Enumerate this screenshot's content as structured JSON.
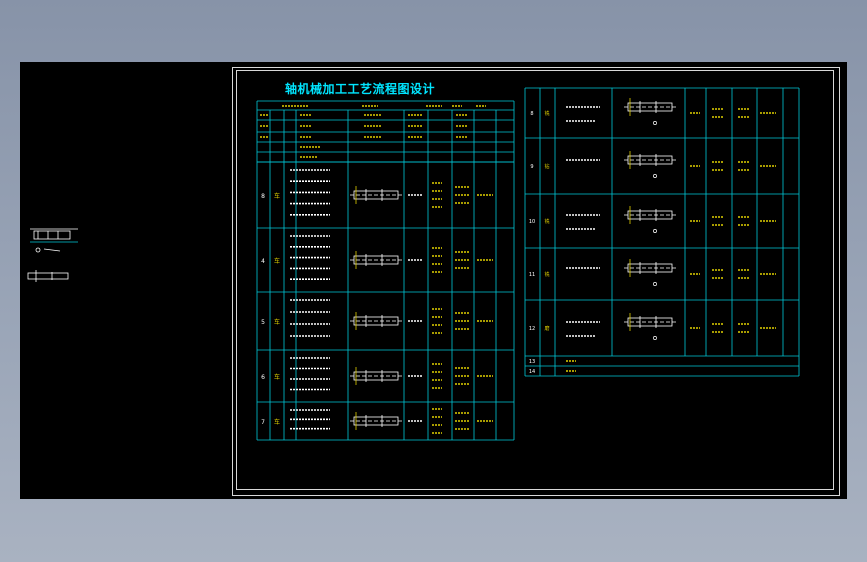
{
  "drawing": {
    "title": "轴机械加工工艺流程图设计"
  },
  "left_table": {
    "rows": [
      {
        "no": "8",
        "label": "车"
      },
      {
        "no": "4",
        "label": "车"
      },
      {
        "no": "5",
        "label": "车"
      },
      {
        "no": "6",
        "label": "车"
      },
      {
        "no": "7",
        "label": "车"
      }
    ]
  },
  "right_table": {
    "rows": [
      {
        "no": "8",
        "label": "铣"
      },
      {
        "no": "9",
        "label": "钻"
      },
      {
        "no": "10",
        "label": "铣"
      },
      {
        "no": "11",
        "label": "铣"
      },
      {
        "no": "12",
        "label": "磨"
      },
      {
        "no": "13",
        "label": ""
      },
      {
        "no": "14",
        "label": ""
      }
    ]
  },
  "colors": {
    "background": "#000000",
    "table_lines": "#00c8d8",
    "text": "#ffffff",
    "title": "#00e5ff",
    "accent_yellow": "#e0d000",
    "frame": "#d8d8d8"
  }
}
